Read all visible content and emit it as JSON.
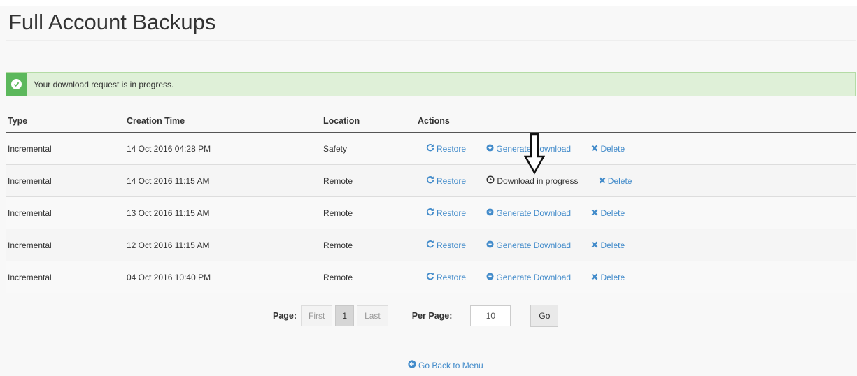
{
  "page": {
    "title": "Full Account Backups"
  },
  "alert": {
    "message": "Your download request is in progress.",
    "icon": "check-circle-icon",
    "color": "#5cb85c"
  },
  "table": {
    "headers": {
      "type": "Type",
      "creation_time": "Creation Time",
      "location": "Location",
      "actions": "Actions"
    },
    "rows": [
      {
        "type": "Incremental",
        "creation_time": "14 Oct 2016 04:28 PM",
        "location": "Safety",
        "restore": "Restore",
        "download": "Generate Download",
        "download_state": "generate",
        "delete": "Delete"
      },
      {
        "type": "Incremental",
        "creation_time": "14 Oct 2016 11:15 AM",
        "location": "Remote",
        "restore": "Restore",
        "download": "Download in progress",
        "download_state": "progress",
        "delete": "Delete"
      },
      {
        "type": "Incremental",
        "creation_time": "13 Oct 2016 11:15 AM",
        "location": "Remote",
        "restore": "Restore",
        "download": "Generate Download",
        "download_state": "generate",
        "delete": "Delete"
      },
      {
        "type": "Incremental",
        "creation_time": "12 Oct 2016 11:15 AM",
        "location": "Remote",
        "restore": "Restore",
        "download": "Generate Download",
        "download_state": "generate",
        "delete": "Delete"
      },
      {
        "type": "Incremental",
        "creation_time": "04 Oct 2016 10:40 PM",
        "location": "Remote",
        "restore": "Restore",
        "download": "Generate Download",
        "download_state": "generate",
        "delete": "Delete"
      }
    ]
  },
  "pagination": {
    "page_label": "Page:",
    "first": "First",
    "current": "1",
    "last": "Last",
    "per_page_label": "Per Page:",
    "per_page_value": "10",
    "go": "Go"
  },
  "footer": {
    "back_link": "Go Back to Menu"
  },
  "colors": {
    "link": "#428bca",
    "delete_icon": "#428bca",
    "alert_bg": "#dff0d8"
  }
}
